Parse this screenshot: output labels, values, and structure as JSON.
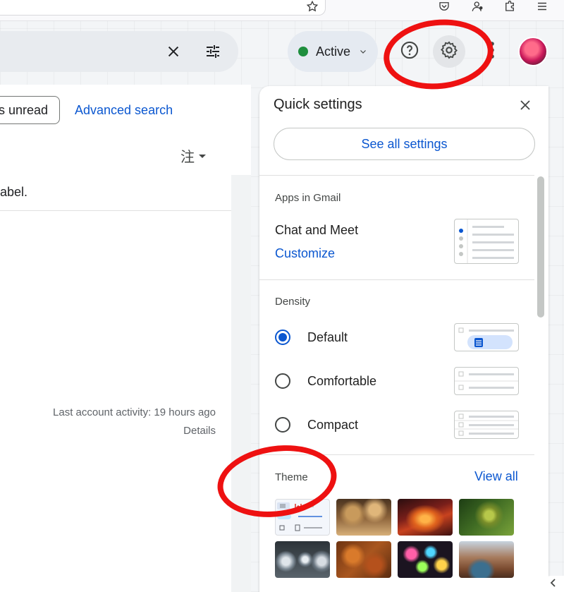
{
  "browser": {
    "icons": [
      "star-icon",
      "pocket-icon",
      "account-icon",
      "extensions-icon",
      "menu-icon"
    ]
  },
  "header": {
    "status_label": "Active",
    "status_color": "#1e8e3e",
    "icons": [
      "close-icon",
      "tune-icon",
      "help-icon",
      "gear-icon",
      "apps-more-icon"
    ]
  },
  "mail_view": {
    "filter_chip_label": "s unread",
    "advanced_search_label": "Advanced search",
    "sort_glyph": "注",
    "truncated_text": "abel.",
    "activity_text": "Last account activity: 19 hours ago",
    "details_label": "Details"
  },
  "quick_settings": {
    "title": "Quick settings",
    "see_all_label": "See all settings",
    "apps_section": {
      "title": "Apps in Gmail",
      "item_label": "Chat and Meet",
      "customize_label": "Customize"
    },
    "density_section": {
      "title": "Density",
      "options": [
        {
          "label": "Default",
          "selected": true
        },
        {
          "label": "Comfortable",
          "selected": false
        },
        {
          "label": "Compact",
          "selected": false
        }
      ]
    },
    "theme_section": {
      "title": "Theme",
      "view_all_label": "View all",
      "tiles": [
        "default",
        "chess",
        "canyon",
        "leaf",
        "pipes",
        "autumn-leaves",
        "bokeh",
        "desert-lake"
      ]
    }
  },
  "colors": {
    "accent_blue": "#0b57d0",
    "annotation_red": "#ee1111"
  }
}
